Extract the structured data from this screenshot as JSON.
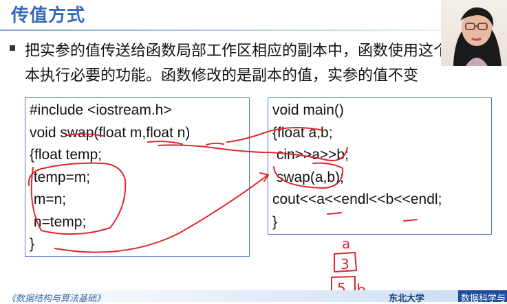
{
  "slide": {
    "title": "传值方式",
    "bullet": "把实参的值传送给函数局部工作区相应的副本中，函数使用这个副本执行必要的功能。函数修改的是副本的值，实参的值不变",
    "code_left": [
      "#include <iostream.h>",
      "void swap(float m,float n)",
      "{float temp;",
      " temp=m;",
      " m=n;",
      " n=temp;",
      "}"
    ],
    "code_right": [
      "void main()",
      "{float a,b;",
      " cin>>a>>b;",
      " swap(a,b);",
      "cout<<a<<endl<<b<<endl;",
      "}"
    ],
    "handwriting": {
      "label_a": "a",
      "value_a": "3",
      "value_b": "5",
      "label_b": "b"
    },
    "footer": {
      "left": "《数据结构与算法基础》",
      "logo": "东北大学",
      "right": "数据科学与"
    }
  },
  "colors": {
    "title": "#3568b8",
    "ink": "#e0262a",
    "box_border": "#4a78b5"
  }
}
